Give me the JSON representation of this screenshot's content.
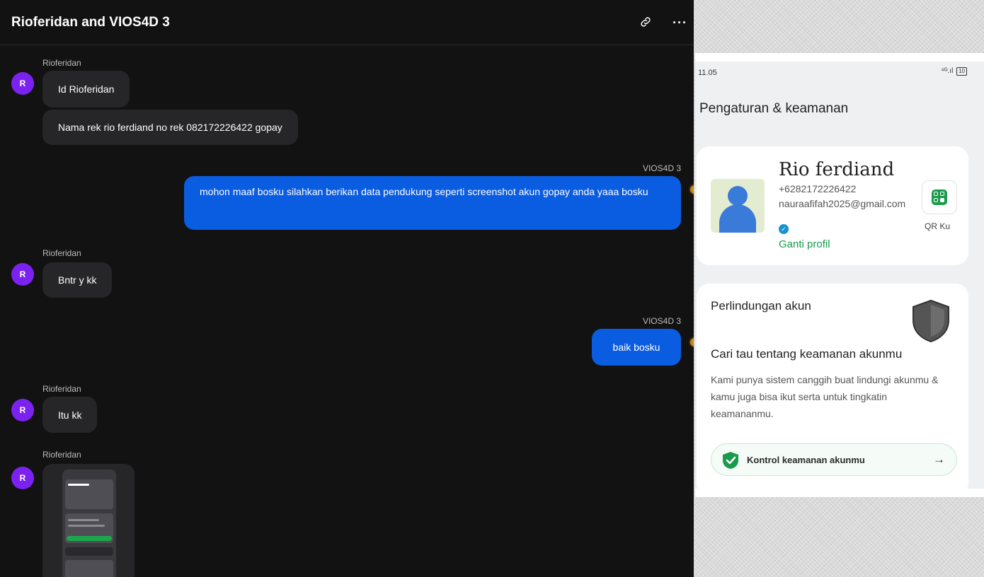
{
  "chat": {
    "title": "Rioferidan and VIOS4D 3",
    "header_icons": {
      "link": "link-icon",
      "more": "more-icon"
    },
    "messages": [
      {
        "sender": "Rioferidan",
        "avatar": "R",
        "bubbles": [
          "Id Rioferidan",
          "Nama rek rio ferdiand no rek 082172226422 gopay"
        ]
      },
      {
        "sender": "VIOS4D 3",
        "text": "mohon maaf bosku silahkan berikan data pendukung seperti screenshot akun gopay anda yaaa bosku"
      },
      {
        "sender": "Rioferidan",
        "avatar": "R",
        "text": "Bntr y kk"
      },
      {
        "sender": "VIOS4D 3",
        "text": "baik bosku"
      },
      {
        "sender": "Rioferidan",
        "avatar": "R",
        "text": "Itu kk"
      },
      {
        "sender": "Rioferidan",
        "avatar": "R",
        "attachment": "image-thumbnail"
      }
    ],
    "colors": {
      "outgoing": "#0a5ce0",
      "incoming": "#262628",
      "avatar": "#7c22f0"
    }
  },
  "phone": {
    "status_time": "11.05",
    "status_signal": "⁴ᴳ.ıl",
    "battery": "10",
    "title": "Pengaturan & keamanan",
    "profile": {
      "name": "Rio ferdiand",
      "phone": "+6282172226422",
      "email": "nauraafifah2025@gmail.com",
      "edit_label": "Ganti profil",
      "qr_label": "QR Ku"
    },
    "protection": {
      "title": "Perlindungan akun",
      "subtitle": "Cari tau tentang keamanan akunmu",
      "description": "Kami punya sistem canggih buat lindungi akunmu & kamu juga bisa ikut serta untuk tingkatin keamananmu.",
      "button_label": "Kontrol keamanan akunmu",
      "button_arrow": "→"
    },
    "colors": {
      "accent_green": "#1a9b4c"
    }
  }
}
